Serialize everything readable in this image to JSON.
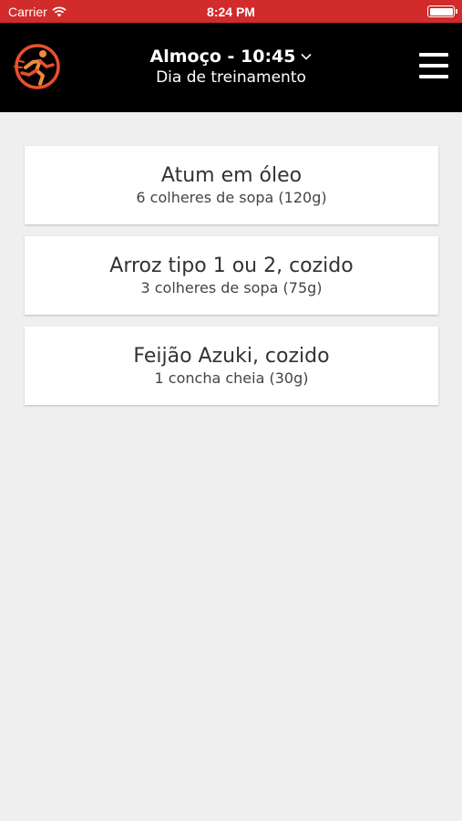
{
  "status_bar": {
    "carrier": "Carrier",
    "time": "8:24 PM",
    "icons": [
      "wifi-icon",
      "battery-icon"
    ]
  },
  "header": {
    "meal_title": "Almoço - 10:45",
    "subtitle": "Dia de treinamento",
    "icons": [
      "runner-logo-icon",
      "chevron-down-icon",
      "hamburger-menu-icon"
    ]
  },
  "colors": {
    "status_bar": "#d12b2b",
    "nav_bar": "#000000",
    "background": "#efefef",
    "card": "#ffffff",
    "logo_accent": "#e8502a"
  },
  "foods": [
    {
      "name": "Atum em óleo",
      "portion": "6 colheres de sopa (120g)"
    },
    {
      "name": "Arroz tipo 1 ou 2, cozido",
      "portion": "3 colheres de sopa (75g)"
    },
    {
      "name": "Feijão Azuki, cozido",
      "portion": "1 concha cheia (30g)"
    }
  ]
}
